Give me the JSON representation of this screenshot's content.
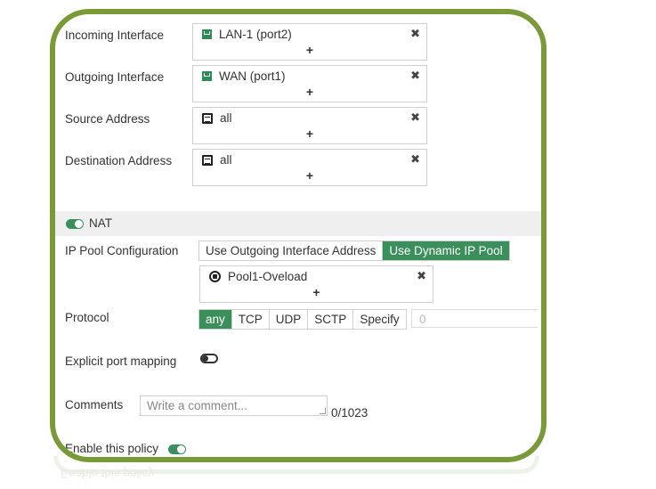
{
  "policy": {
    "incoming_interface": {
      "label": "Incoming Interface",
      "value": "LAN-1 (port2)"
    },
    "outgoing_interface": {
      "label": "Outgoing Interface",
      "value": "WAN (port1)"
    },
    "source_address": {
      "label": "Source Address",
      "value": "all"
    },
    "destination_address": {
      "label": "Destination Address",
      "value": "all"
    },
    "add_symbol": "+",
    "remove_symbol": "✖"
  },
  "nat": {
    "label": "NAT",
    "enabled": true,
    "ip_pool_label": "IP Pool Configuration",
    "ip_pool_options": [
      "Use Outgoing Interface Address",
      "Use Dynamic IP Pool"
    ],
    "ip_pool_selected": "Use Dynamic IP Pool",
    "pool_value": "Pool1-Oveload",
    "protocol_label": "Protocol",
    "protocol_options": [
      "any",
      "TCP",
      "UDP",
      "SCTP",
      "Specify"
    ],
    "protocol_selected": "any",
    "protocol_number_placeholder": "0",
    "explicit_port_mapping_label": "Explicit port mapping",
    "explicit_port_mapping_enabled": false
  },
  "comments": {
    "label": "Comments",
    "placeholder": "Write a comment...",
    "counter": "0/1023"
  },
  "enable_policy": {
    "label": "Enable this policy",
    "enabled": true
  },
  "reflection_text": "Enable this policy",
  "colors": {
    "frame_border": "#7a9a3a",
    "accent_green": "#3a8f5b",
    "section_bg": "#efefef"
  },
  "icons": {
    "interface": "interface-port-icon",
    "address": "address-object-icon",
    "pool": "ip-pool-icon"
  }
}
